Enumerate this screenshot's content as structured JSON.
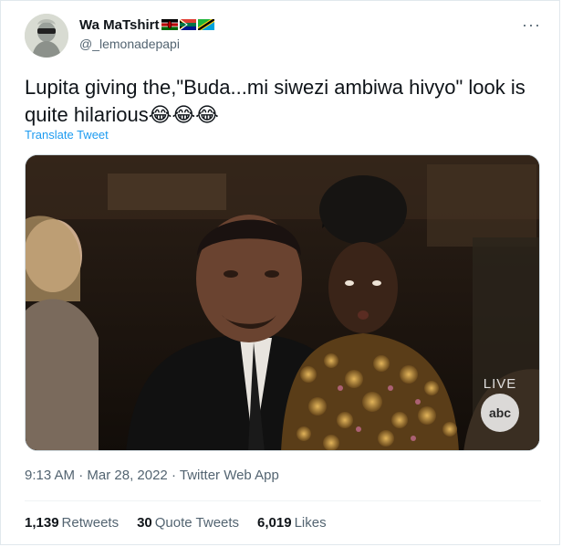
{
  "tweet": {
    "display_name": "Wa MaTshirt",
    "handle": "@_lemonadepapi",
    "text": "Lupita giving the,\"Buda...mi siwezi ambiwa hivyo\" look is quite hilarious",
    "emojis": "😂😂😂",
    "translate_label": "Translate Tweet",
    "more_label": "···"
  },
  "media": {
    "live_label": "LIVE",
    "network_logo_text": "abc"
  },
  "meta": {
    "time": "9:13 AM",
    "separator": "·",
    "date": "Mar 28, 2022",
    "source": "Twitter Web App"
  },
  "stats": [
    {
      "count": "1,139",
      "label": "Retweets"
    },
    {
      "count": "30",
      "label": "Quote Tweets"
    },
    {
      "count": "6,019",
      "label": "Likes"
    }
  ],
  "colors": {
    "link": "#1d9bf0",
    "secondary_text": "#536471",
    "primary_text": "#0f1419"
  }
}
